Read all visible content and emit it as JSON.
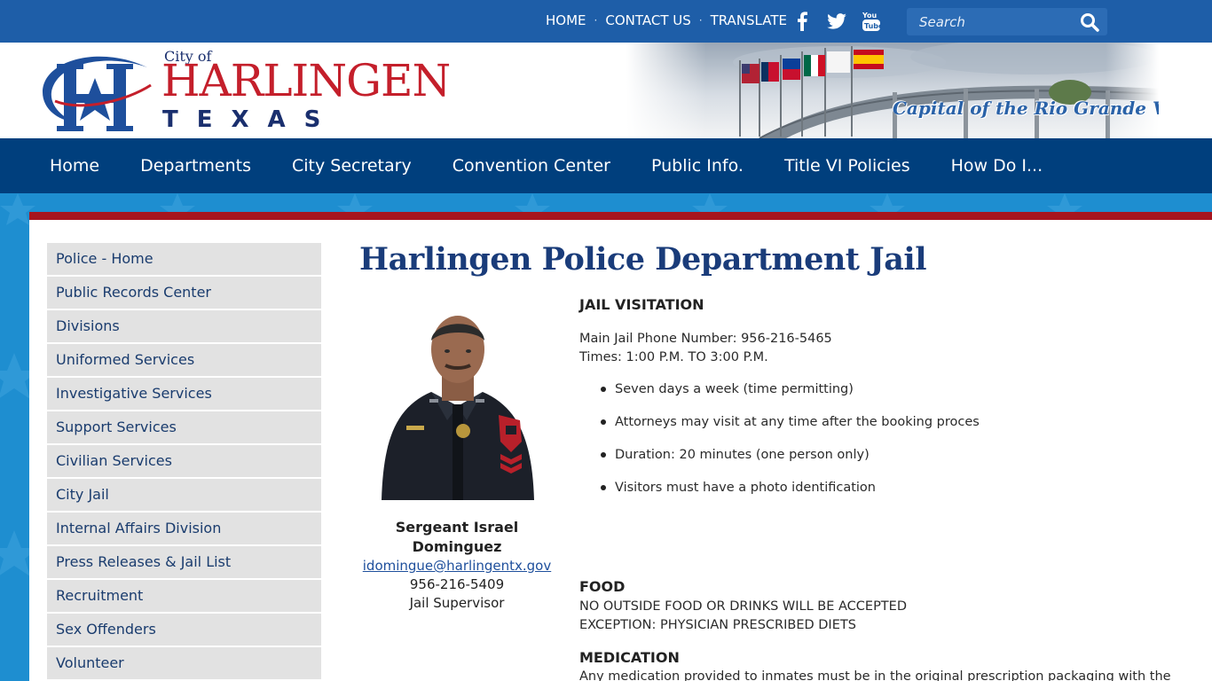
{
  "top_bar": {
    "links": [
      "HOME",
      "CONTACT US",
      "TRANSLATE"
    ],
    "search_placeholder": "Search",
    "social_icons": [
      "facebook-icon",
      "twitter-icon",
      "youtube-icon"
    ]
  },
  "header": {
    "logo": {
      "city_of": "City of",
      "name": "HARLINGEN",
      "state": "TEXAS"
    },
    "banner_tagline": "Capital of the Rio Grande Valley"
  },
  "main_nav": {
    "items": [
      "Home",
      "Departments",
      "City Secretary",
      "Convention Center",
      "Public Info.",
      "Title VI Policies",
      "How Do I..."
    ]
  },
  "sidebar": {
    "items": [
      "Police - Home",
      "Public Records Center",
      "Divisions",
      "Uniformed Services",
      "Investigative Services",
      "Support Services",
      "Civilian Services",
      "City Jail",
      "Internal Affairs Division",
      "Press Releases & Jail List",
      "Recruitment",
      "Sex Offenders",
      "Volunteer"
    ]
  },
  "page": {
    "title": "Harlingen Police Department Jail",
    "staff": {
      "name_line1": "Sergeant Israel",
      "name_line2": "Dominguez",
      "email": "idomingue@harlingentx.gov",
      "phone": "956-216-5409",
      "role": "Jail Supervisor"
    },
    "visitation": {
      "heading": "JAIL VISITATION",
      "phone_line": "Main Jail Phone Number: 956-216-5465",
      "times_line": "Times: 1:00 P.M. TO 3:00 P.M.",
      "rules": [
        "Seven days a week (time permitting)",
        "Attorneys may visit at any time after the booking proces",
        "Duration: 20 minutes (one person only)",
        "Visitors must have a photo identification"
      ]
    },
    "food": {
      "heading": "FOOD",
      "line1": "NO OUTSIDE FOOD OR DRINKS WILL BE ACCEPTED",
      "line2": "EXCEPTION: PHYSICIAN PRESCRIBED DIETS"
    },
    "medication": {
      "heading": "MEDICATION",
      "line1": "Any medication provided to inmates must be in the original prescription packaging with the"
    }
  },
  "colors": {
    "top_bar": "#1e5ea8",
    "main_nav": "#003f7d",
    "accent_red": "#a7151e",
    "background_blue": "#1e8ed0",
    "title_blue": "#1a3c7a",
    "sidebar_item": "#e2e2e2"
  }
}
